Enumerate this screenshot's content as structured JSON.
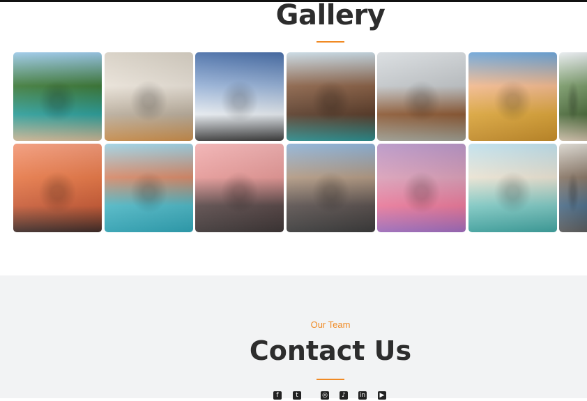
{
  "gallery": {
    "title": "Gallery",
    "accent": "#f08a24",
    "images": [
      {
        "name": "boat-lagoon-photo",
        "colors": [
          "#9cc9e8",
          "#3f7a3a",
          "#2f9e9a",
          "#c9b291"
        ]
      },
      {
        "name": "white-arches-photo",
        "colors": [
          "#d7d0c4",
          "#e8e1d7",
          "#b9ad9c",
          "#c48a4a"
        ]
      },
      {
        "name": "mountain-bridge-photo",
        "colors": [
          "#4a6fa8",
          "#98b2d6",
          "#e4e9ee",
          "#3c3c3c"
        ]
      },
      {
        "name": "venice-canal-photo",
        "colors": [
          "#c8d9e3",
          "#8a6248",
          "#5b3e2c",
          "#2c8a8a"
        ]
      },
      {
        "name": "london-eye-photo",
        "colors": [
          "#d9dde0",
          "#c2c6c9",
          "#8c5a36",
          "#9a9a8e"
        ]
      },
      {
        "name": "wheat-field-photo",
        "colors": [
          "#6da5d8",
          "#f1b98f",
          "#d9a43c",
          "#c08a2a"
        ]
      },
      {
        "name": "hills-valley-photo",
        "colors": [
          "#e8ecef",
          "#7a9a6a",
          "#4f6d3f",
          "#c7b9a3"
        ]
      },
      {
        "name": "sunset-beach-photo",
        "colors": [
          "#f29a7a",
          "#e67a4a",
          "#c95f3b",
          "#3c2b28"
        ]
      },
      {
        "name": "venice-lagoon-photo",
        "colors": [
          "#9fd2e4",
          "#d68a6a",
          "#4fb6c4",
          "#2f9fb0"
        ]
      },
      {
        "name": "temple-gate-photo",
        "colors": [
          "#f1b1b2",
          "#e59a98",
          "#5a4a4a",
          "#3c3535"
        ]
      },
      {
        "name": "busy-street-photo",
        "colors": [
          "#8fb3d7",
          "#b29a84",
          "#5b5250",
          "#3a3a3a"
        ]
      },
      {
        "name": "harbor-reflection-photo",
        "colors": [
          "#b896c7",
          "#d9a0b8",
          "#e87a9a",
          "#9a6ab8"
        ]
      },
      {
        "name": "venice-church-photo",
        "colors": [
          "#bfe0ec",
          "#e9e2d2",
          "#7fc7c2",
          "#3f9f9c"
        ]
      },
      {
        "name": "city-crowd-photo",
        "colors": [
          "#d9d5cd",
          "#8a7868",
          "#4f6f8a",
          "#5a5a5a"
        ]
      }
    ]
  },
  "contact": {
    "eyebrow": "Our Team",
    "title": "Contact Us"
  },
  "socials": [
    {
      "name": "facebook-icon",
      "glyph": "f"
    },
    {
      "name": "twitter-icon",
      "glyph": "t"
    },
    {
      "name": "instagram-icon",
      "glyph": "◎"
    },
    {
      "name": "tiktok-icon",
      "glyph": "♪"
    },
    {
      "name": "linkedin-icon",
      "glyph": "in"
    },
    {
      "name": "youtube-icon",
      "glyph": "▶"
    }
  ]
}
